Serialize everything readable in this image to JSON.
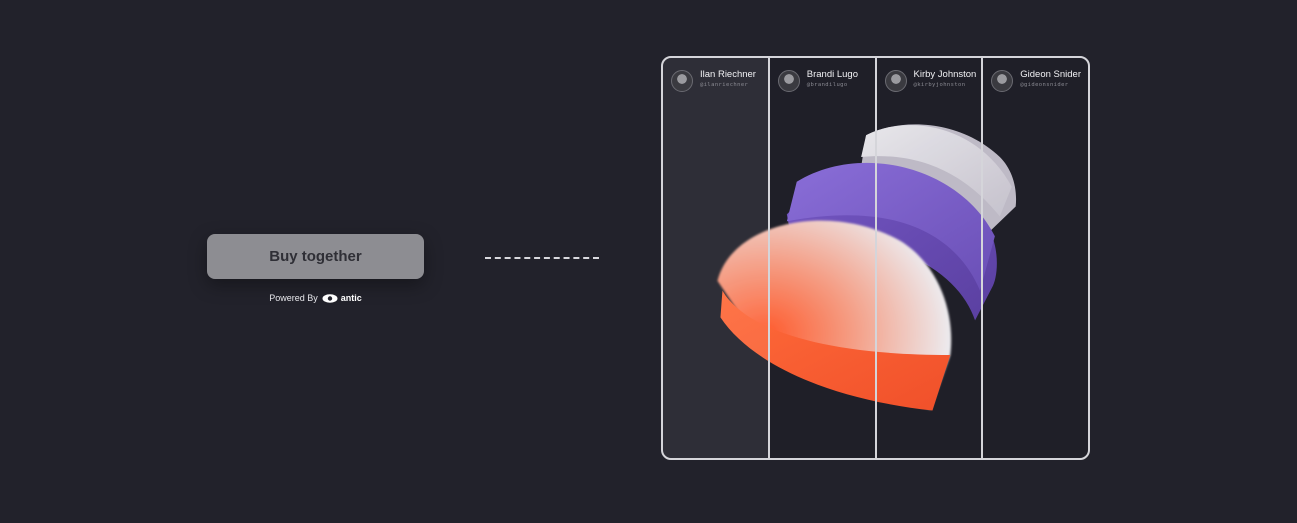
{
  "cta": {
    "buy_label": "Buy together",
    "powered_by": "Powered By",
    "brand": "antic"
  },
  "panel": {
    "participants": [
      {
        "name": "Ilan Riechner",
        "handle": "@ilanriechner"
      },
      {
        "name": "Brandi Lugo",
        "handle": "@brandilugo"
      },
      {
        "name": "Kirby Johnston",
        "handle": "@kirbyjohnston"
      },
      {
        "name": "Gideon Snider",
        "handle": "@gideonsnider"
      }
    ]
  },
  "icons": {
    "brand_logo": "eye-icon",
    "avatar": "avatar-icon"
  },
  "colors": {
    "background": "#22222b",
    "button": "#8d8d92",
    "panel_border": "#d5d5da",
    "slab_orange": "#f26a3d",
    "slab_purple": "#7c5cc8",
    "slab_white": "#e9e7ee"
  }
}
